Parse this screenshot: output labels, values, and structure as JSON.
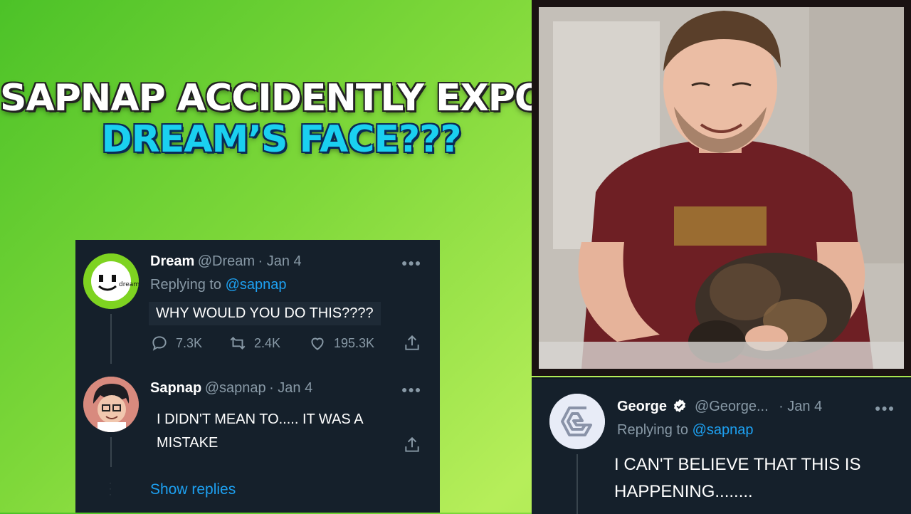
{
  "title": {
    "line1": "SAPNAP ACCIDENTLY EXPOSES",
    "line2": "DREAM’S FACE???"
  },
  "tweets": {
    "dream": {
      "name": "Dream",
      "handle": "@Dream",
      "date": "· Jan 4",
      "replying_label": "Replying to",
      "replying_to": "@sapnap",
      "text": "WHY WOULD YOU DO THIS????",
      "replies": "7.3K",
      "retweets": "2.4K",
      "likes": "195.3K",
      "avatar_text": "dream"
    },
    "sapnap": {
      "name": "Sapnap",
      "handle": "@sapnap",
      "date": "· Jan 4",
      "text_line1": "I DIDN'T MEAN TO..... IT WAS A",
      "text_line2": "MISTAKE",
      "show_replies": "Show replies"
    },
    "george": {
      "name": "George",
      "handle": "@George...",
      "date": "· Jan 4",
      "replying_label": "Replying to",
      "replying_to": "@sapnap",
      "text_line1": "I CAN'T BELIEVE THAT THIS IS",
      "text_line2": "HAPPENING........"
    }
  },
  "icons": {
    "more": "more-horizontal-icon",
    "reply": "reply-icon",
    "retweet": "retweet-icon",
    "like": "heart-icon",
    "share": "share-icon",
    "verified": "verified-badge-icon"
  },
  "colors": {
    "card_bg": "#15202b",
    "link": "#1da1f2",
    "muted": "#8899a6",
    "title_white": "#ffffff",
    "title_cyan": "#1ad0f0",
    "dream_green": "#7ed321"
  }
}
